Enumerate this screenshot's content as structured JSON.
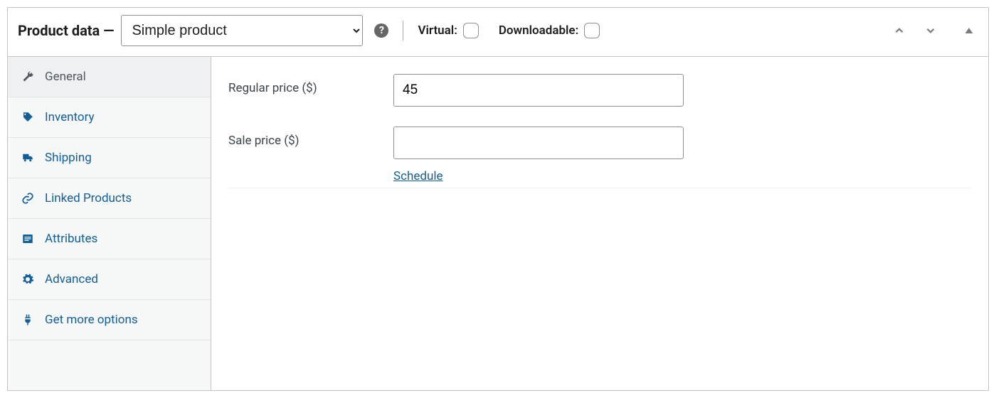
{
  "header": {
    "title": "Product data —",
    "product_type_selected": "Simple product",
    "virtual_label": "Virtual:",
    "downloadable_label": "Downloadable:",
    "virtual_checked": false,
    "downloadable_checked": false
  },
  "tabs": [
    {
      "id": "general",
      "label": "General",
      "icon": "wrench-icon",
      "active": true
    },
    {
      "id": "inventory",
      "label": "Inventory",
      "icon": "tag-icon",
      "active": false
    },
    {
      "id": "shipping",
      "label": "Shipping",
      "icon": "truck-icon",
      "active": false
    },
    {
      "id": "linked",
      "label": "Linked Products",
      "icon": "link-icon",
      "active": false
    },
    {
      "id": "attributes",
      "label": "Attributes",
      "icon": "list-icon",
      "active": false
    },
    {
      "id": "advanced",
      "label": "Advanced",
      "icon": "gear-icon",
      "active": false
    },
    {
      "id": "more",
      "label": "Get more options",
      "icon": "plug-icon",
      "active": false
    }
  ],
  "general": {
    "regular_price_label": "Regular price ($)",
    "regular_price_value": "45",
    "sale_price_label": "Sale price ($)",
    "sale_price_value": "",
    "schedule_link": "Schedule"
  }
}
